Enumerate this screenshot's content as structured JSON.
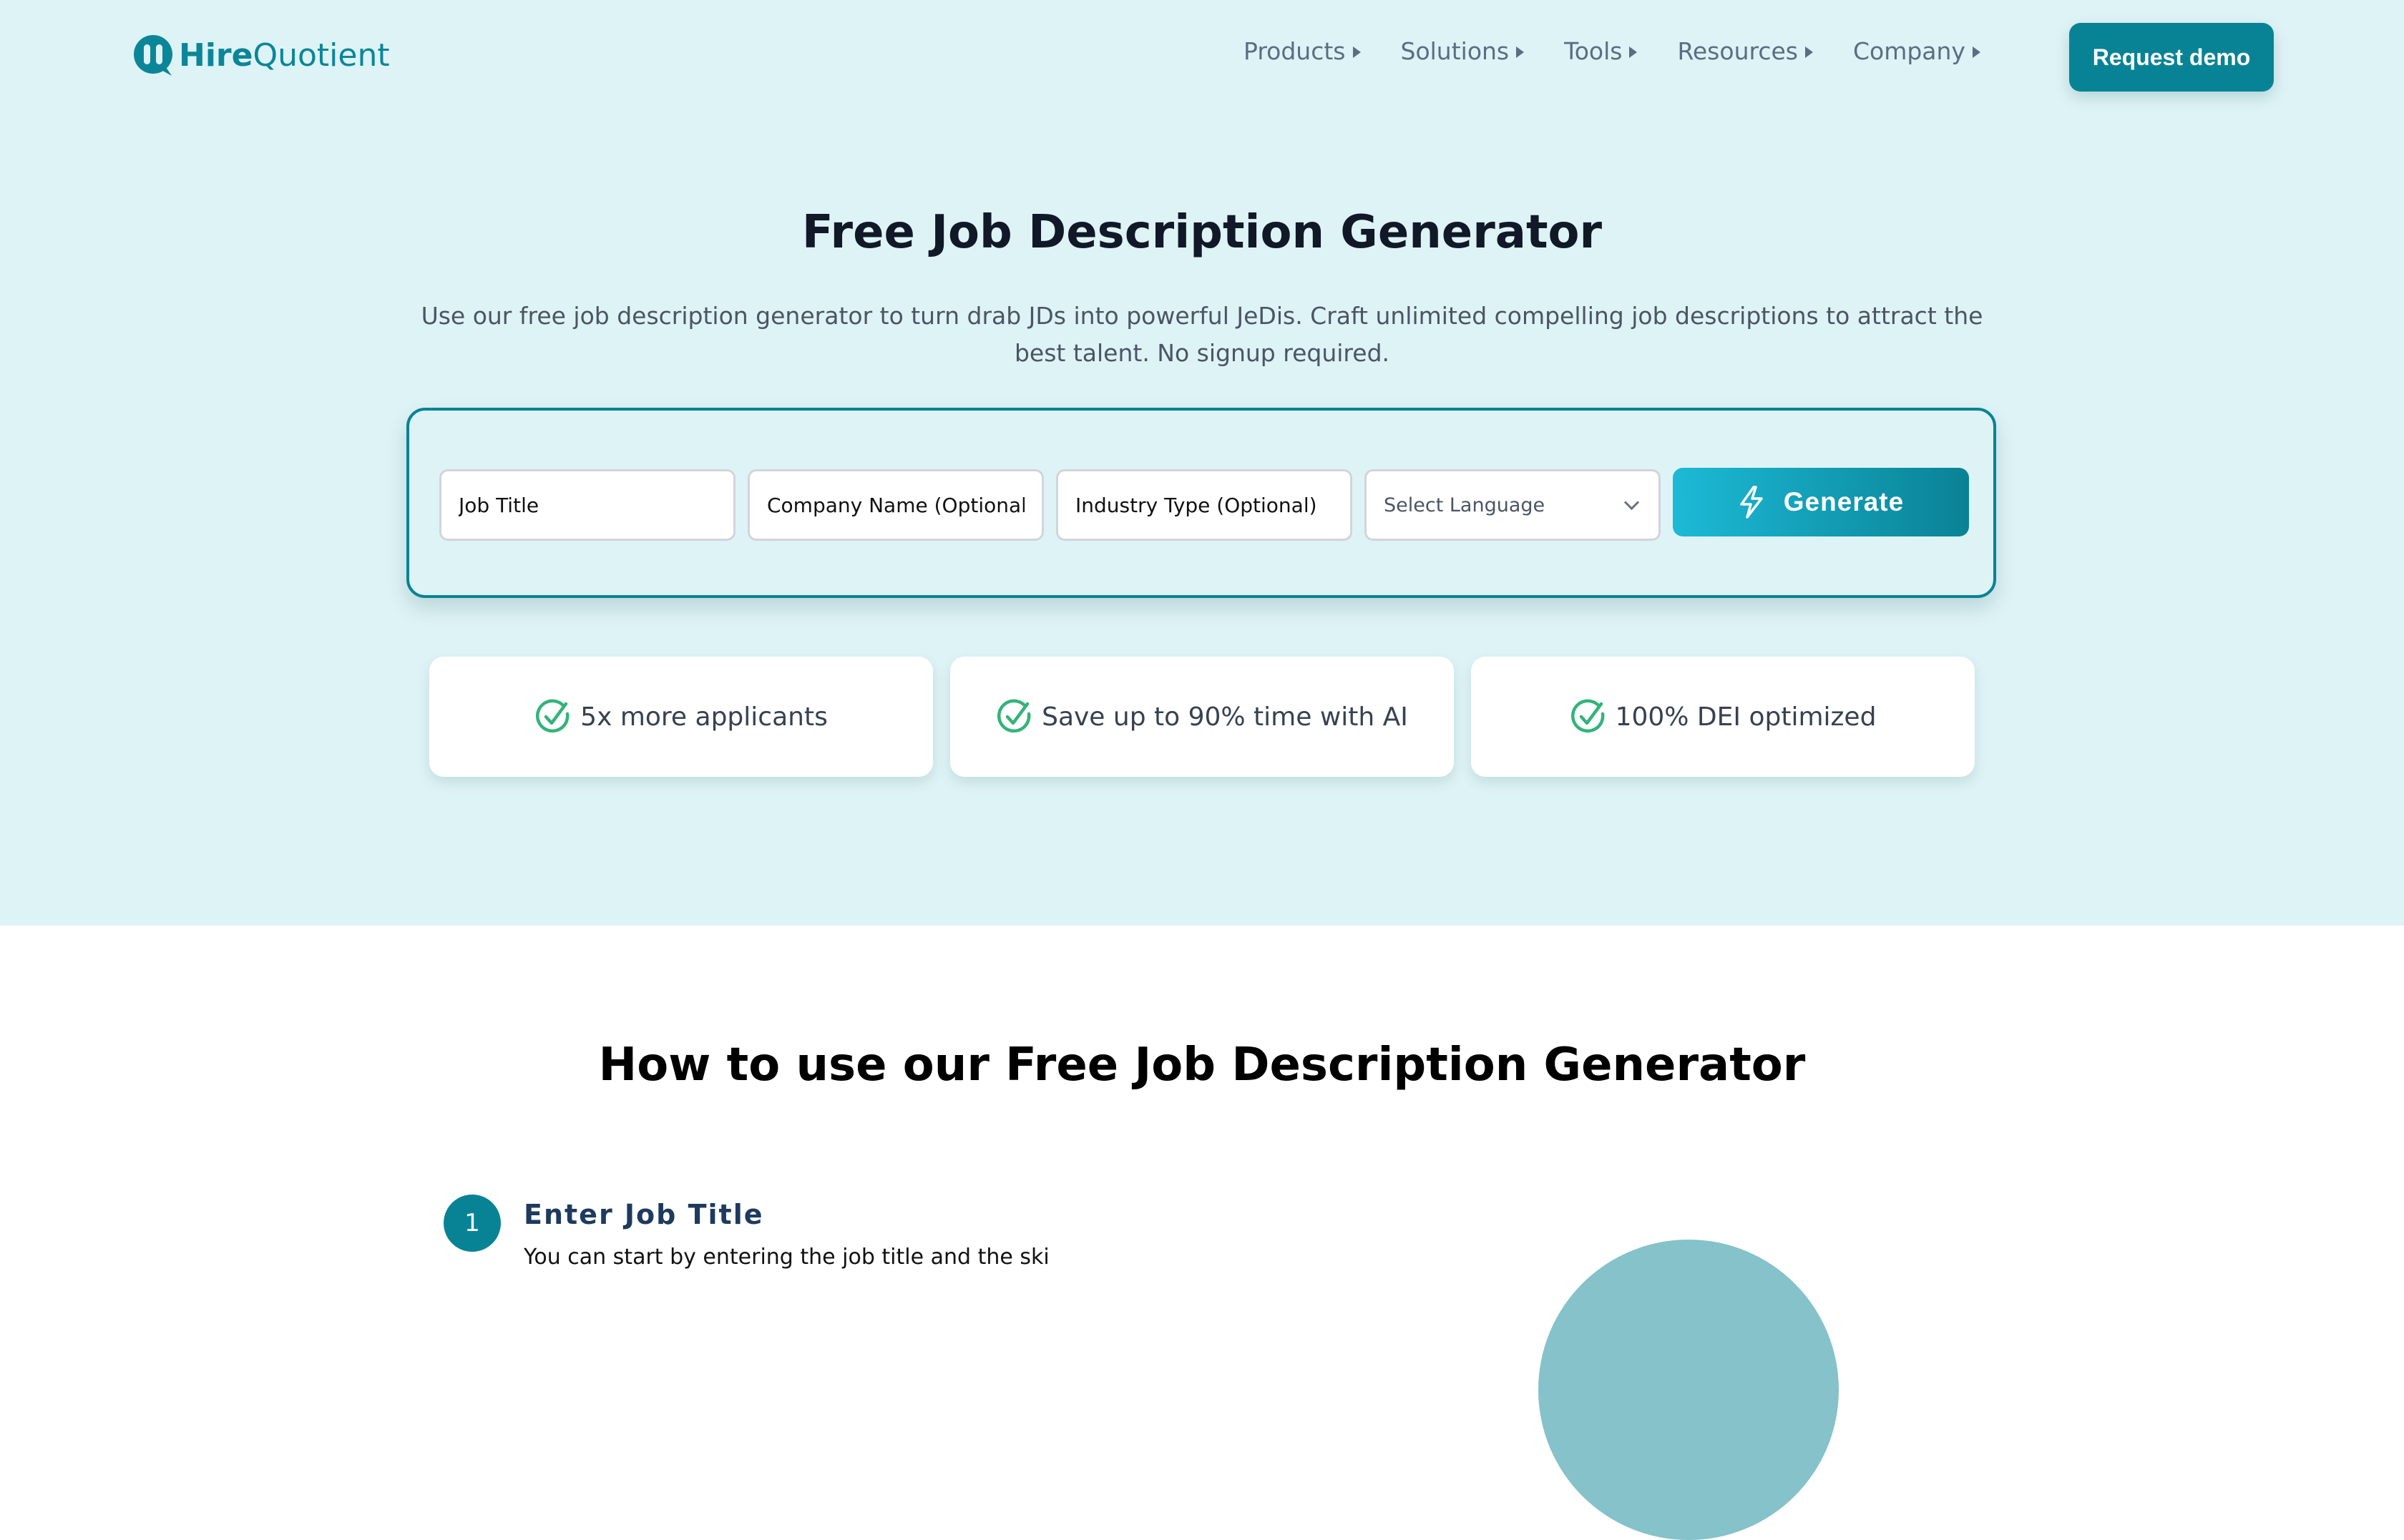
{
  "brand": {
    "name_bold": "Hire",
    "name_light": "Quotient",
    "primary_color": "#088395",
    "hero_bg": "#def3f5",
    "check_color": "#34b37a"
  },
  "nav": {
    "items": [
      {
        "label": "Products"
      },
      {
        "label": "Solutions"
      },
      {
        "label": "Tools"
      },
      {
        "label": "Resources"
      },
      {
        "label": "Company"
      }
    ],
    "cta_label": "Request demo"
  },
  "hero": {
    "title": "Free Job Description Generator",
    "subtitle": "Use our free job description generator to turn drab JDs into powerful JeDis. Craft unlimited compelling job descriptions to attract the best talent. No signup required."
  },
  "form": {
    "job_title": {
      "value": "",
      "placeholder": "Job Title"
    },
    "company_name": {
      "value": "",
      "placeholder": "Company Name (Optional)"
    },
    "industry_type": {
      "value": "",
      "placeholder": "Industry Type (Optional)"
    },
    "language": {
      "selected": "Select Language"
    },
    "generate_label": "Generate"
  },
  "features": [
    {
      "icon": "check-circle-icon",
      "label": "5x more applicants"
    },
    {
      "icon": "check-circle-icon",
      "label": "Save up to 90% time with AI"
    },
    {
      "icon": "check-circle-icon",
      "label": "100% DEI optimized"
    }
  ],
  "how_to": {
    "title": "How to use our Free Job Description Generator",
    "steps": [
      {
        "number": "1",
        "title": "Enter Job Title",
        "description": "You can start by entering the job title and the ski"
      }
    ]
  }
}
